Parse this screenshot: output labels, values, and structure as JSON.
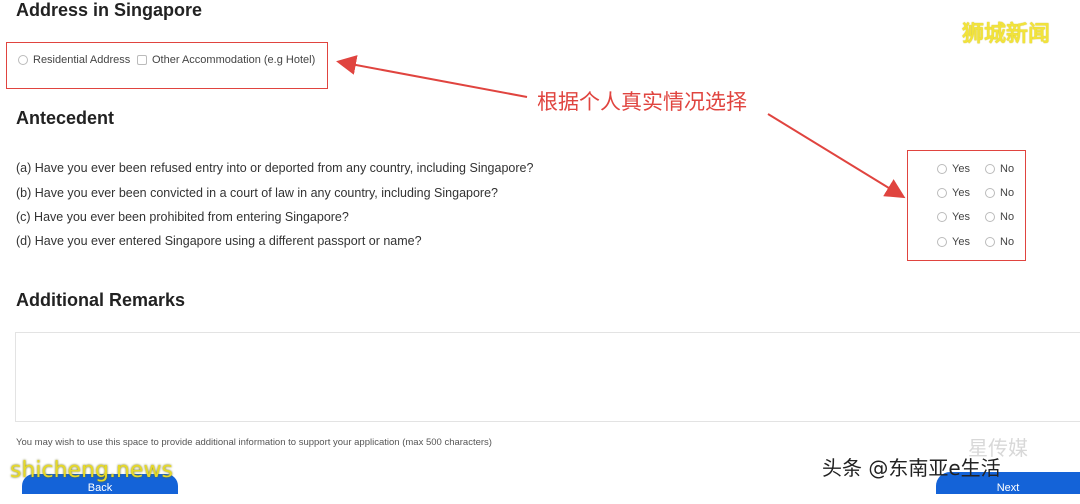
{
  "address": {
    "heading": "Address in Singapore",
    "options": [
      "Residential Address",
      "Other Accommodation (e.g Hotel)"
    ]
  },
  "annotation": {
    "text": "根据个人真实情况选择",
    "color": "#e0443f"
  },
  "antecedent": {
    "heading": "Antecedent",
    "questions": [
      "(a) Have you ever been refused entry into or deported from any country, including Singapore?",
      "(b) Have you ever been convicted in a court of law in any country, including Singapore?",
      "(c) Have you ever been prohibited from entering Singapore?",
      "(d) Have you ever entered Singapore using a different passport or name?"
    ],
    "yes_label": "Yes",
    "no_label": "No"
  },
  "remarks": {
    "heading": "Additional Remarks",
    "hint": "You may wish to use this space to provide additional information to support your application (max 500 characters)"
  },
  "buttons": {
    "back": "Back",
    "next": "Next"
  },
  "watermarks": {
    "top_right": "狮城新闻",
    "bottom_left": "shicheng.news",
    "bottom_right": "头条 @东南亚e生活",
    "faint": "星传媒"
  },
  "colors": {
    "accent_red": "#e0443f",
    "button_blue": "#1463d8",
    "watermark_yellow": "#f2e33a"
  }
}
